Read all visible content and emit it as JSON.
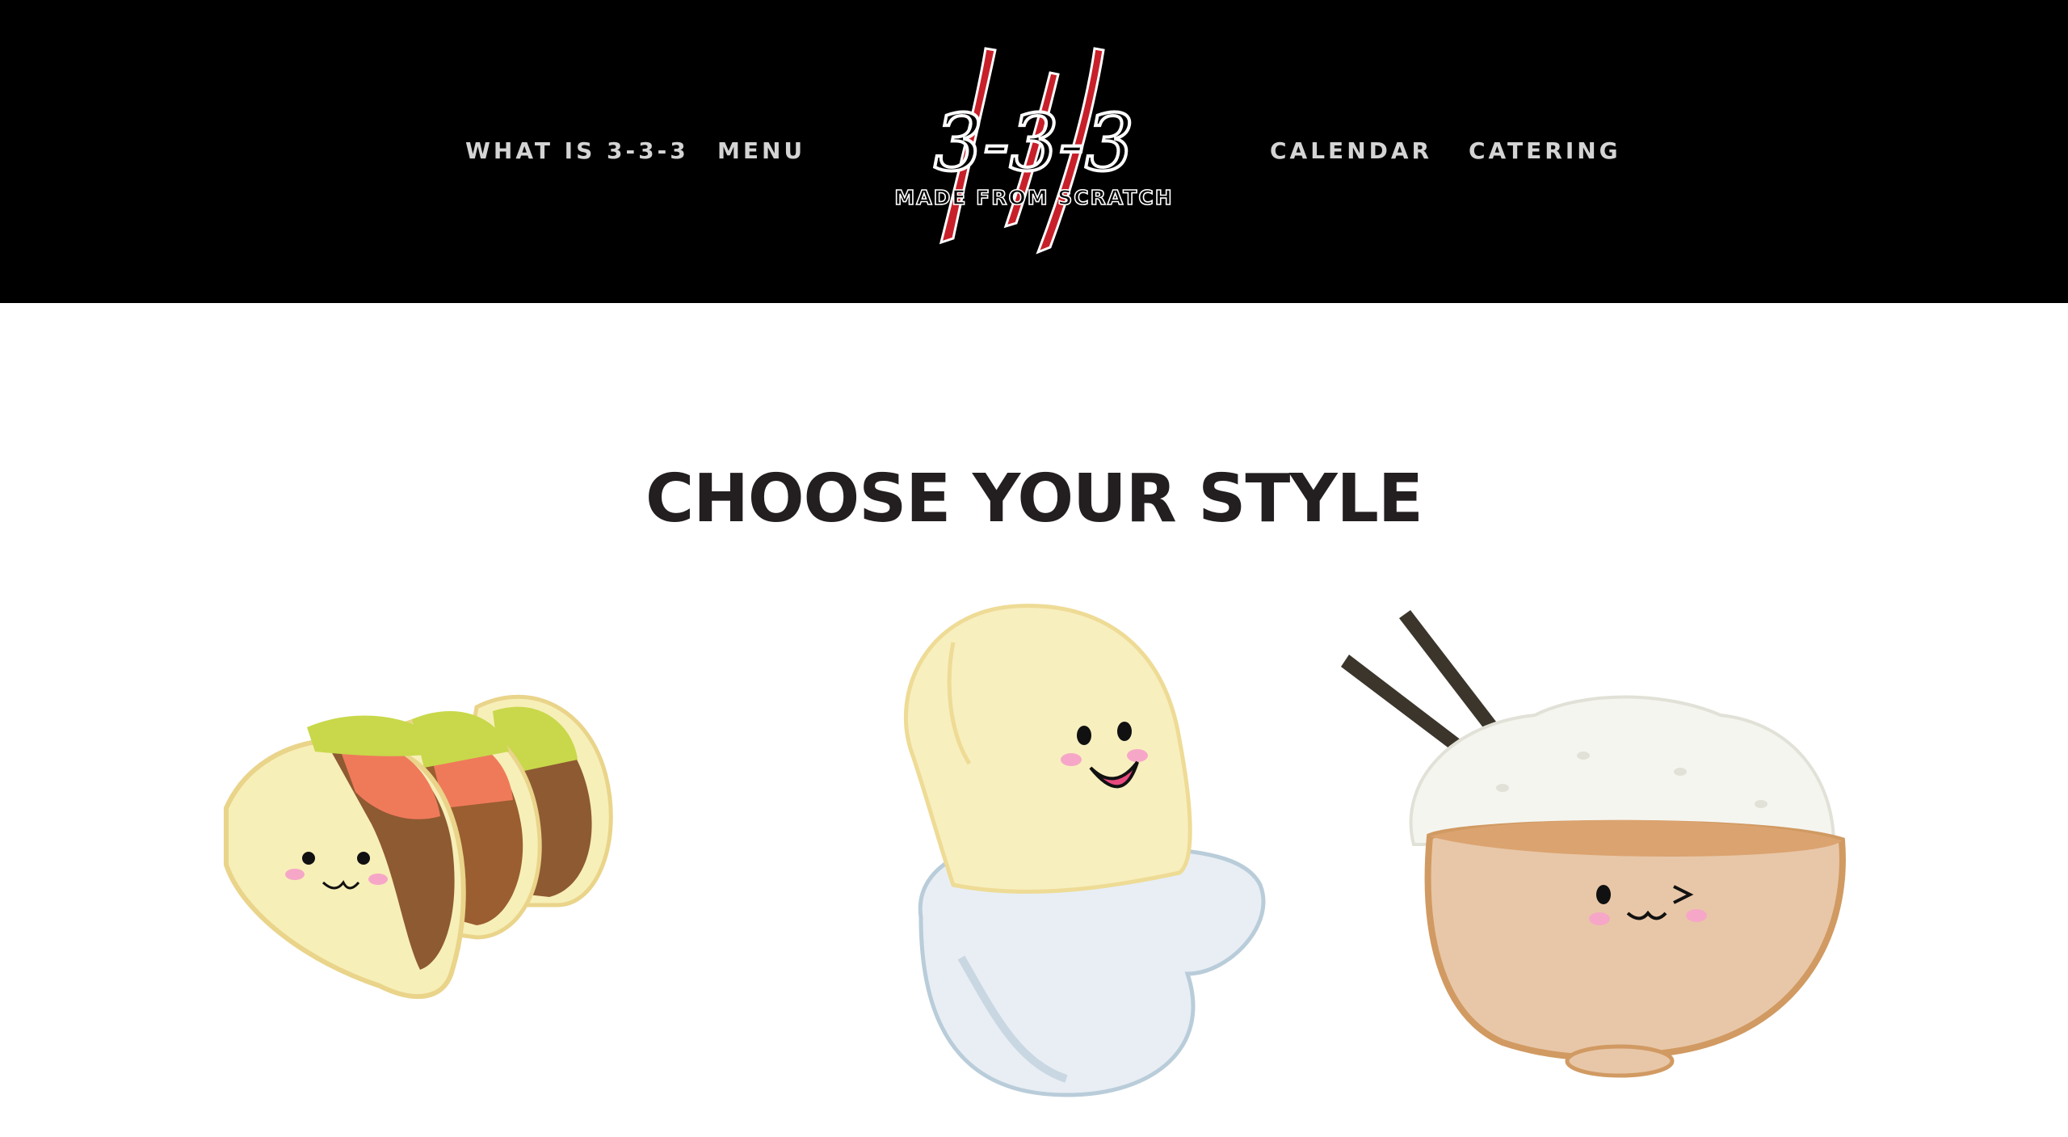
{
  "nav": {
    "left": [
      {
        "label": "WHAT IS 3-3-3"
      },
      {
        "label": "MENU"
      }
    ],
    "right": [
      {
        "label": "CALENDAR"
      },
      {
        "label": "CATERING"
      }
    ]
  },
  "logo": {
    "mark": "3-3-3",
    "tagline": "MADE FROM SCRATCH",
    "icon": "claw-scratch-logo"
  },
  "main": {
    "title": "CHOOSE YOUR STYLE",
    "options": [
      {
        "icon": "taco-icon"
      },
      {
        "icon": "bao-bun-icon"
      },
      {
        "icon": "rice-bowl-icon"
      }
    ]
  },
  "colors": {
    "header_bg": "#000000",
    "nav_text": "#d4d4d4",
    "title_text": "#231f20",
    "logo_red": "#c8202a"
  }
}
